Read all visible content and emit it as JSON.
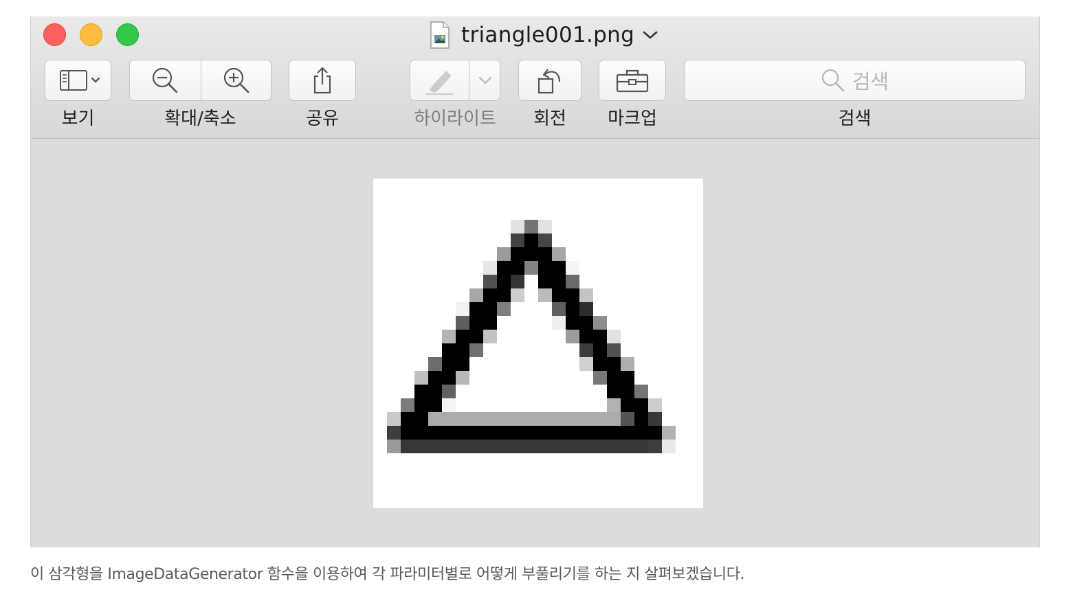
{
  "window": {
    "filename": "triangle001.png",
    "file_icon": "png-document-icon"
  },
  "toolbar": {
    "view_label": "보기",
    "zoom_label": "확대/축소",
    "share_label": "공유",
    "highlight_label": "하이라이트",
    "rotate_label": "회전",
    "markup_label": "마크업",
    "search_label": "검색",
    "search_placeholder": "검색",
    "icons": [
      "sidebar-icon",
      "chevron-down-icon",
      "zoom-out-icon",
      "zoom-in-icon",
      "share-icon",
      "highlighter-icon",
      "rotate-left-icon",
      "toolbox-icon",
      "search-icon"
    ]
  },
  "image": {
    "description_shape": "triangle",
    "grid_size": 24
  },
  "caption": "이 삼각형을 ImageDataGenerator 함수을 이용하여 각 파라미터별로 어떻게 부풀리기를 하는 지 살펴보겠습니다."
}
